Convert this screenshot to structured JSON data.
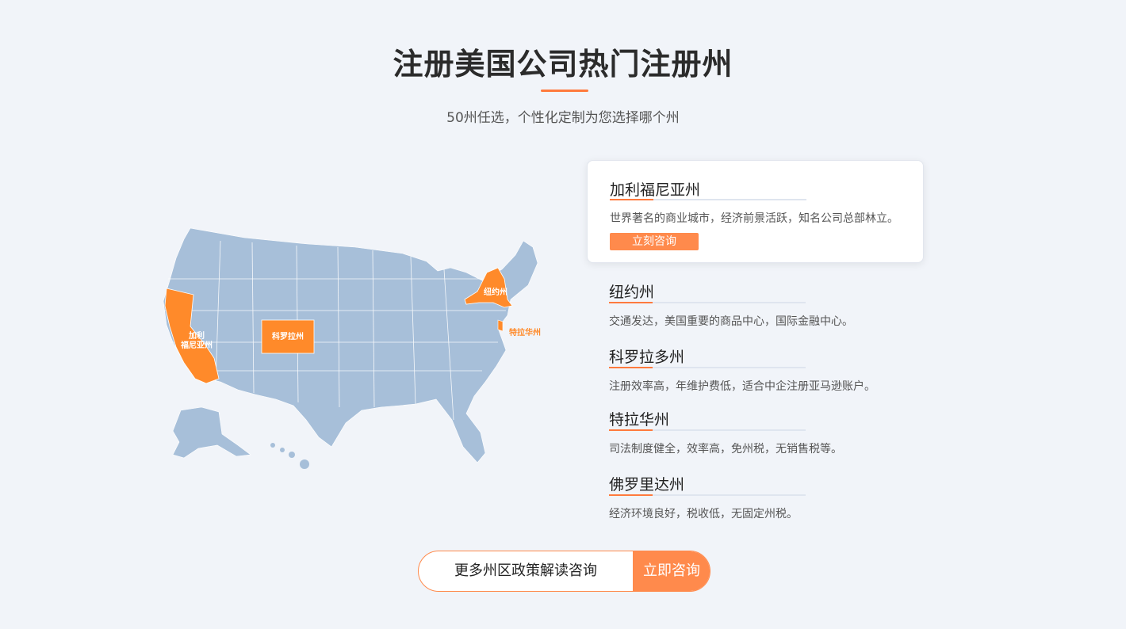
{
  "header": {
    "title": "注册美国公司热门注册州",
    "subtitle": "50州任选，个性化定制为您选择哪个州"
  },
  "map": {
    "labels": {
      "california": "加利\n福尼亚州",
      "colorado": "科罗拉州",
      "newyork": "纽约州",
      "delaware": "特拉华州"
    },
    "base_color": "#a7bfd9",
    "highlight_color": "#ff8a2a"
  },
  "states": [
    {
      "name": "加利福尼亚州",
      "desc": "世界著名的商业城市，经济前景活跃，知名公司总部林立。",
      "button": "立刻咨询",
      "active": true
    },
    {
      "name": "纽约州",
      "desc": "交通发达，美国重要的商品中心，国际金融中心。"
    },
    {
      "name": "科罗拉多州",
      "desc": "注册效率高，年维护费低，适合中企注册亚马逊账户。"
    },
    {
      "name": "特拉华州",
      "desc": "司法制度健全，效率高，免州税，无销售税等。"
    },
    {
      "name": "佛罗里达州",
      "desc": "经济环境良好，税收低，无固定州税。"
    }
  ],
  "cta": {
    "label": "更多州区政策解读咨询",
    "button": "立即咨询"
  },
  "colors": {
    "accent": "#ff7a3d",
    "button": "#ff8a4c",
    "background": "#f1f4f9"
  }
}
